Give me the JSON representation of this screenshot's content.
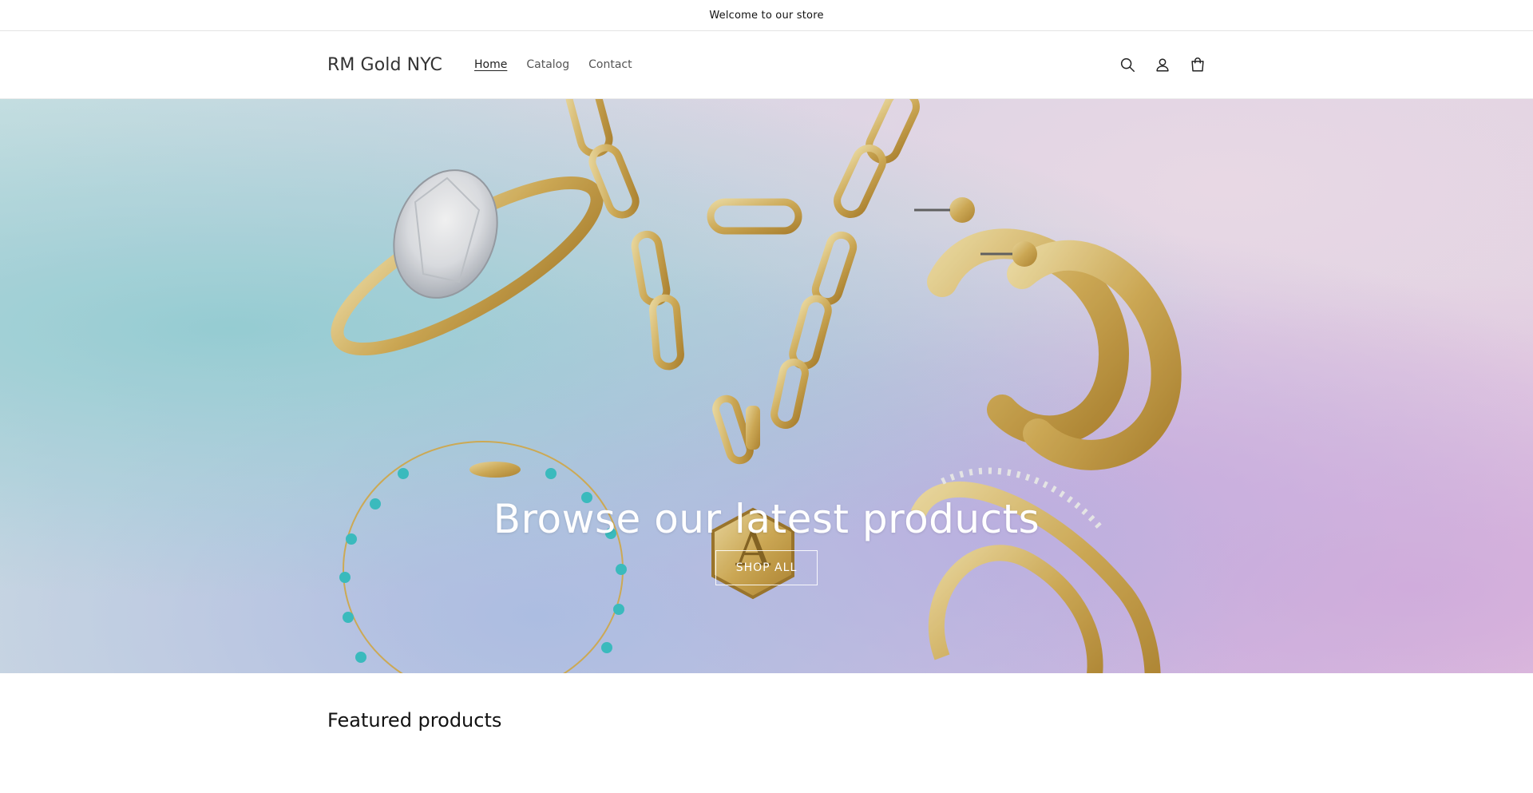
{
  "announcement": {
    "text": "Welcome to our store"
  },
  "header": {
    "logo": "RM Gold NYC",
    "nav": [
      {
        "label": "Home",
        "active": true
      },
      {
        "label": "Catalog",
        "active": false
      },
      {
        "label": "Contact",
        "active": false
      }
    ],
    "icons": [
      "search-icon",
      "account-icon",
      "cart-icon"
    ]
  },
  "hero": {
    "title": "Browse our latest products",
    "button_label": "SHOP ALL",
    "image_content": [
      "diamond-ring",
      "paperclip-chain-necklace",
      "letter-a-pendant",
      "gold-hoop-earrings",
      "turquoise-bead-bracelet",
      "crossover-diamond-ring"
    ]
  },
  "featured": {
    "heading": "Featured products"
  },
  "colors": {
    "gold": "#d9b45a",
    "turquoise": "#3ec6c9",
    "text": "#121212"
  }
}
